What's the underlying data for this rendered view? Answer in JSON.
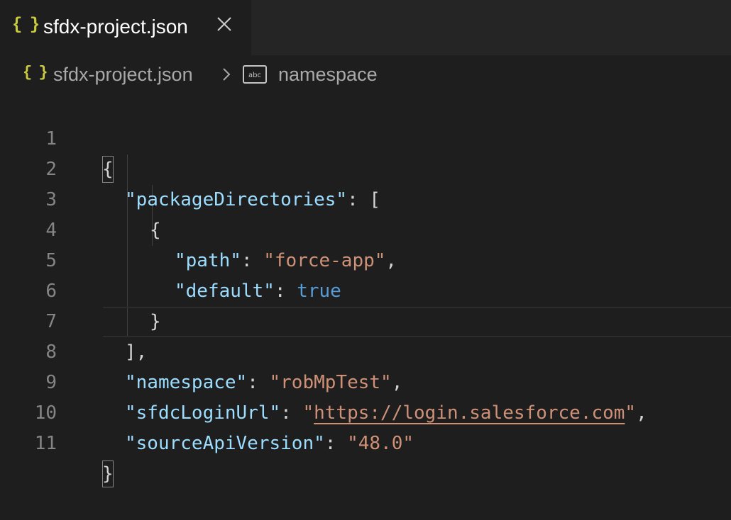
{
  "tab": {
    "icon": "{ }",
    "label": "sfdx-project.json"
  },
  "breadcrumb": {
    "file_icon": "{ }",
    "file": "sfdx-project.json",
    "symbol_icon_text": "abc",
    "symbol": "namespace"
  },
  "lines": [
    {
      "num": "1"
    },
    {
      "num": "2"
    },
    {
      "num": "3"
    },
    {
      "num": "4"
    },
    {
      "num": "5"
    },
    {
      "num": "6"
    },
    {
      "num": "7"
    },
    {
      "num": "8"
    },
    {
      "num": "9"
    },
    {
      "num": "10"
    },
    {
      "num": "11"
    }
  ],
  "code": {
    "open_brace": "{",
    "key_packageDirectories": "\"packageDirectories\"",
    "colon": ":",
    "open_bracket": "[",
    "inner_open": "{",
    "key_path": "\"path\"",
    "val_path": "\"force-app\"",
    "comma": ",",
    "key_default": "\"default\"",
    "val_default": "true",
    "inner_close": "}",
    "close_bracket": "],",
    "key_namespace": "\"namespace\"",
    "val_namespace": "\"robMpTest\"",
    "key_sfdcLoginUrl": "\"sfdcLoginUrl\"",
    "val_quote": "\"",
    "val_sfdcLoginUrl_link": "https://login.salesforce.com",
    "key_sourceApiVersion": "\"sourceApiVersion\"",
    "val_sourceApiVersion": "\"48.0\"",
    "close_brace": "}"
  },
  "colors": {
    "background": "#1e1e1e",
    "key": "#9cdcfe",
    "string": "#ce9178",
    "boolean": "#569cd6",
    "json_icon": "#cbcb41"
  }
}
